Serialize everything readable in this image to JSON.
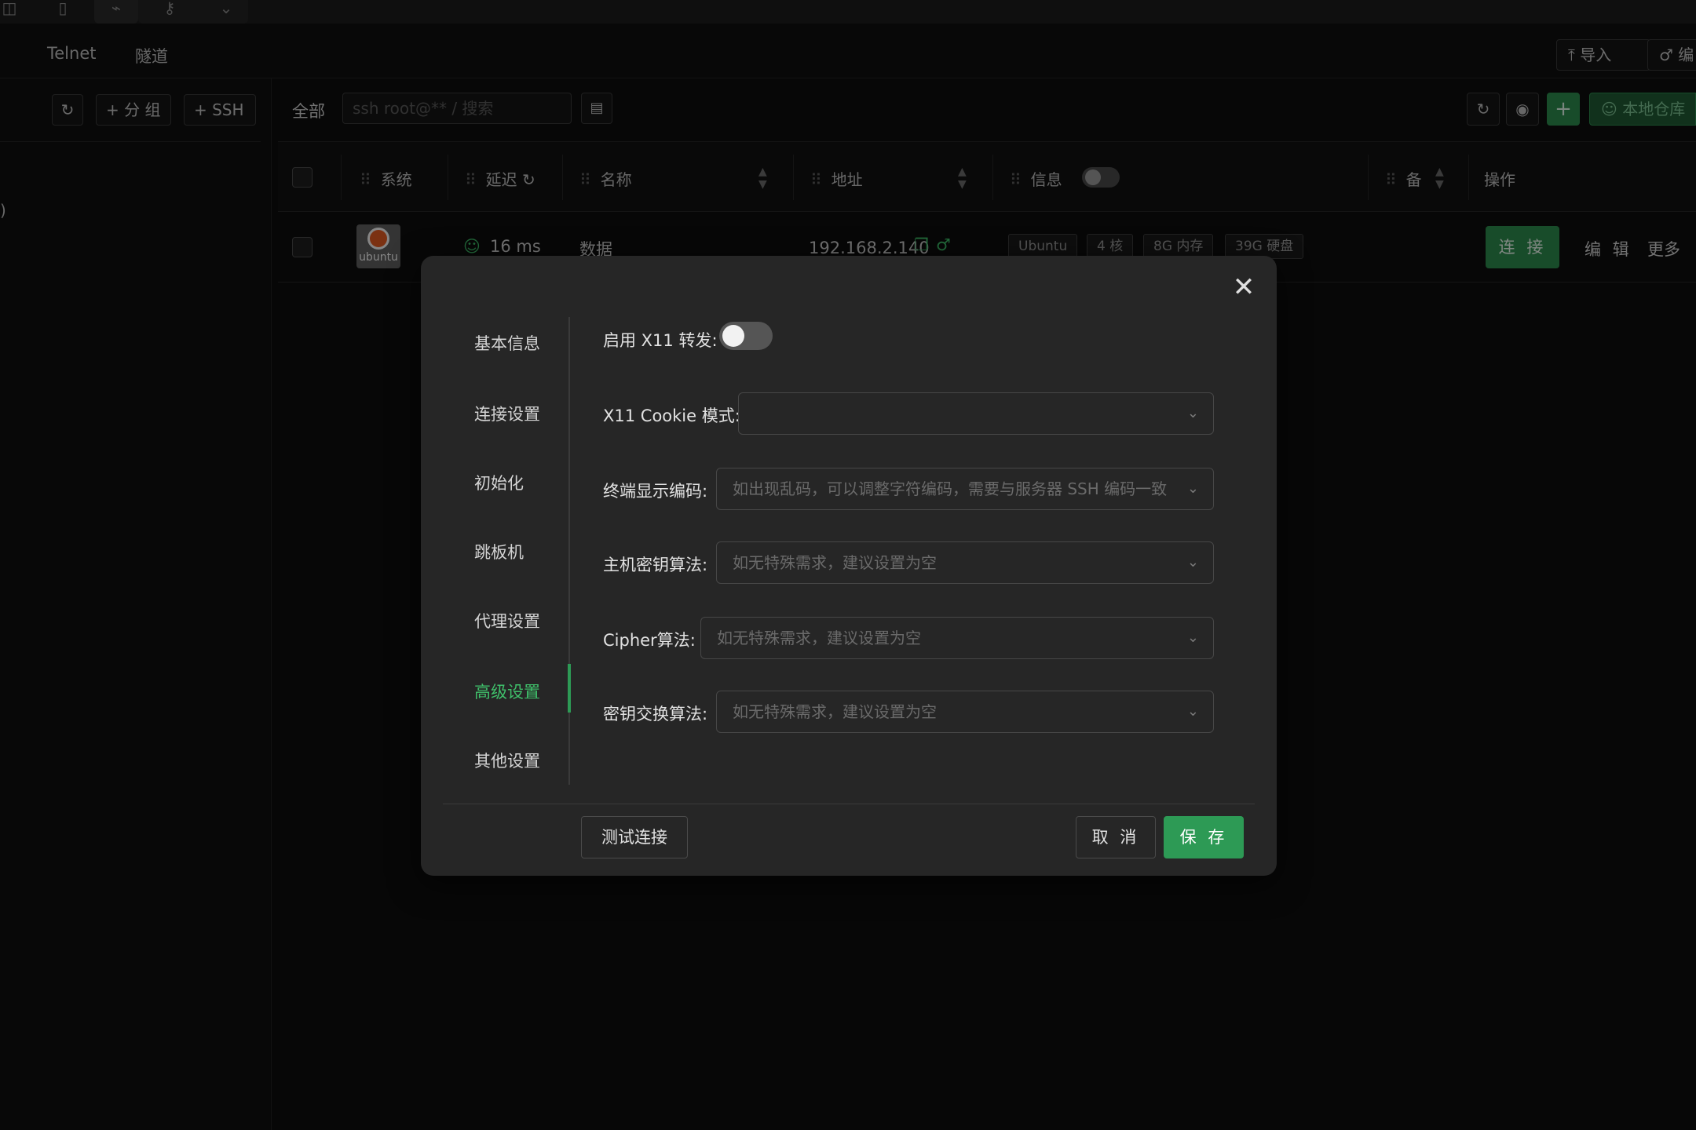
{
  "topstrip": {
    "icons": [
      "image-icon",
      "file-icon",
      "link-icon",
      "key-icon",
      "chevron-down-icon"
    ]
  },
  "nav": {
    "items": [
      {
        "label": "Telnet"
      },
      {
        "label": "隧道"
      }
    ],
    "import_label": "导入",
    "edit_label": "编"
  },
  "left": {
    "add_group_label": "+ 分 组",
    "add_ssh_label": "+ SSH",
    "fragment": ")"
  },
  "toolbar": {
    "scope_label": "全部",
    "search_placeholder": "ssh root@** / 搜索",
    "repo_label": "本地仓库"
  },
  "table": {
    "columns": {
      "system": "系统",
      "latency": "延迟",
      "name": "名称",
      "address": "地址",
      "info": "信息",
      "remark": "备",
      "actions": "操作"
    },
    "rows": [
      {
        "os_logo_text": "ubuntu",
        "latency": "16 ms",
        "name": "数据",
        "address": "192.168.2.140",
        "tags": [
          "Ubuntu",
          "4 核",
          "8G 内存",
          "39G 硬盘"
        ],
        "connect_label": "连 接",
        "edit_label": "编 辑",
        "more_label": "更多"
      }
    ]
  },
  "modal": {
    "nav": [
      {
        "label": "基本信息"
      },
      {
        "label": "连接设置"
      },
      {
        "label": "初始化"
      },
      {
        "label": "跳板机"
      },
      {
        "label": "代理设置"
      },
      {
        "label": "高级设置",
        "active": true
      },
      {
        "label": "其他设置"
      }
    ],
    "fields": {
      "x11": {
        "label": "启用 X11 转发:",
        "enabled": false
      },
      "x11_cookie": {
        "label": "X11 Cookie 模式:",
        "placeholder": ""
      },
      "encoding": {
        "label": "终端显示编码:",
        "placeholder": "如出现乱码，可以调整字符编码，需要与服务器 SSH 编码一致"
      },
      "host_key": {
        "label": "主机密钥算法:",
        "placeholder": "如无特殊需求，建议设置为空"
      },
      "cipher": {
        "label": "Cipher算法:",
        "placeholder": "如无特殊需求，建议设置为空"
      },
      "kex": {
        "label": "密钥交换算法:",
        "placeholder": "如无特殊需求，建议设置为空"
      }
    },
    "buttons": {
      "test": "测试连接",
      "cancel": "取 消",
      "save": "保 存"
    }
  },
  "colors": {
    "accent": "#2d9a55",
    "accent_text": "#3fbf6a",
    "background": "#0d0d0d",
    "modal_bg": "#262626"
  }
}
